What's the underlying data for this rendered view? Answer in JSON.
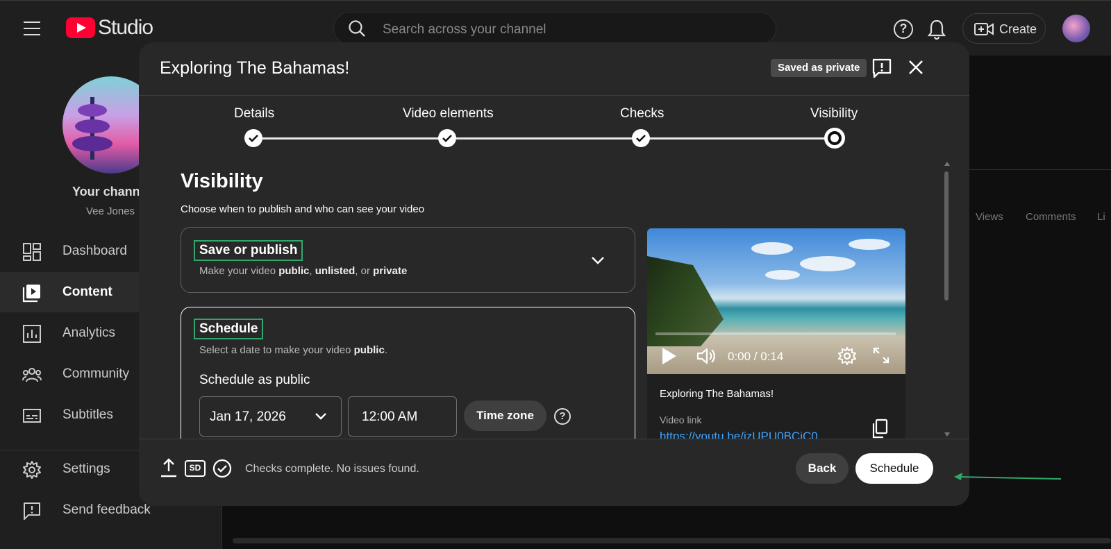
{
  "app": {
    "logo_text": "Studio"
  },
  "search": {
    "placeholder": "Search across your channel"
  },
  "top": {
    "create_label": "Create"
  },
  "sidebar": {
    "channel_name": "Your chann",
    "channel_user": "Vee Jones",
    "items": [
      {
        "label": "Dashboard",
        "icon": "dashboard-icon"
      },
      {
        "label": "Content",
        "icon": "content-icon",
        "active": true
      },
      {
        "label": "Analytics",
        "icon": "analytics-icon"
      },
      {
        "label": "Community",
        "icon": "community-icon"
      },
      {
        "label": "Subtitles",
        "icon": "subtitles-icon"
      },
      {
        "label": "Settings",
        "icon": "gear-icon"
      },
      {
        "label": "Send feedback",
        "icon": "feedback-icon"
      }
    ]
  },
  "background": {
    "col_views": "Views",
    "col_comments": "Comments",
    "col_likes": "Li"
  },
  "modal": {
    "title": "Exploring The Bahamas!",
    "saved_badge": "Saved as private",
    "steps": [
      {
        "label": "Details",
        "state": "done"
      },
      {
        "label": "Video elements",
        "state": "done"
      },
      {
        "label": "Checks",
        "state": "done"
      },
      {
        "label": "Visibility",
        "state": "current"
      }
    ],
    "section_title": "Visibility",
    "section_sub": "Choose when to publish and who can see your video",
    "save_card": {
      "title": "Save or publish",
      "desc_prefix": "Make your video ",
      "opt_public": "public",
      "sep1": ", ",
      "opt_unlisted": "unlisted",
      "sep2": ", or ",
      "opt_private": "private"
    },
    "schedule_card": {
      "title": "Schedule",
      "desc_prefix": "Select a date to make your video ",
      "desc_bold": "public",
      "desc_suffix": ".",
      "schedule_as": "Schedule as public",
      "date": "Jan 17, 2026",
      "time": "12:00 AM",
      "timezone_label": "Time zone"
    },
    "preview": {
      "time": "0:00 / 0:14",
      "progress": 0,
      "title": "Exploring The Bahamas!",
      "link_label": "Video link",
      "link": "https://youtu.be/izUPU0BCiC0"
    },
    "footer": {
      "sd_label": "SD",
      "status": "Checks complete. No issues found.",
      "back_label": "Back",
      "schedule_label": "Schedule"
    }
  },
  "colors": {
    "accent_green": "#2fa96a",
    "link_blue": "#3ea6ff",
    "brand_red": "#ff0033"
  }
}
